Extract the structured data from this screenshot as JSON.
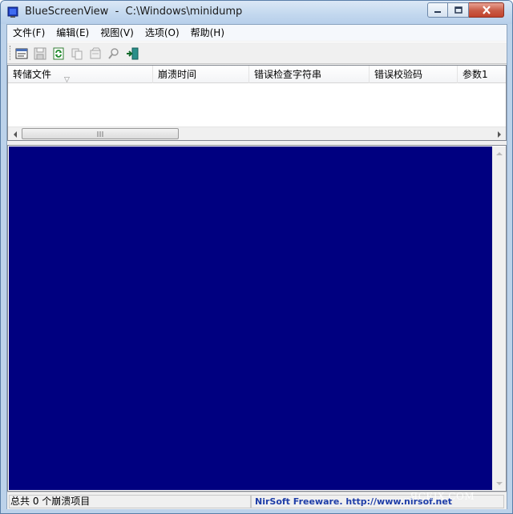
{
  "window": {
    "title": "BlueScreenView  -  C:\\Windows\\minidump",
    "icon": "bluescreen-app-icon"
  },
  "menu": {
    "items": [
      {
        "label": "文件(F)"
      },
      {
        "label": "编辑(E)"
      },
      {
        "label": "视图(V)"
      },
      {
        "label": "选项(O)"
      },
      {
        "label": "帮助(H)"
      }
    ]
  },
  "toolbar": {
    "buttons": [
      {
        "icon": "advanced-options-icon",
        "enabled": true
      },
      {
        "icon": "save-icon",
        "enabled": false
      },
      {
        "icon": "refresh-icon",
        "enabled": true
      },
      {
        "icon": "copy-icon",
        "enabled": false
      },
      {
        "icon": "properties-icon",
        "enabled": false
      },
      {
        "icon": "find-icon",
        "enabled": false
      },
      {
        "icon": "exit-icon",
        "enabled": true
      }
    ]
  },
  "list": {
    "columns": [
      {
        "label": "转储文件"
      },
      {
        "label": "崩溃时间"
      },
      {
        "label": "错误检查字符串"
      },
      {
        "label": "错误校验码"
      },
      {
        "label": "参数1"
      }
    ],
    "sort_indicator": "▽",
    "rows": []
  },
  "preview": {
    "background_color": "#000080"
  },
  "status": {
    "left": "总共 0 个崩溃项目",
    "right": "NirSoft Freeware.  http://www.nirsof.net"
  },
  "watermark": "…ЯCEJX.COM"
}
